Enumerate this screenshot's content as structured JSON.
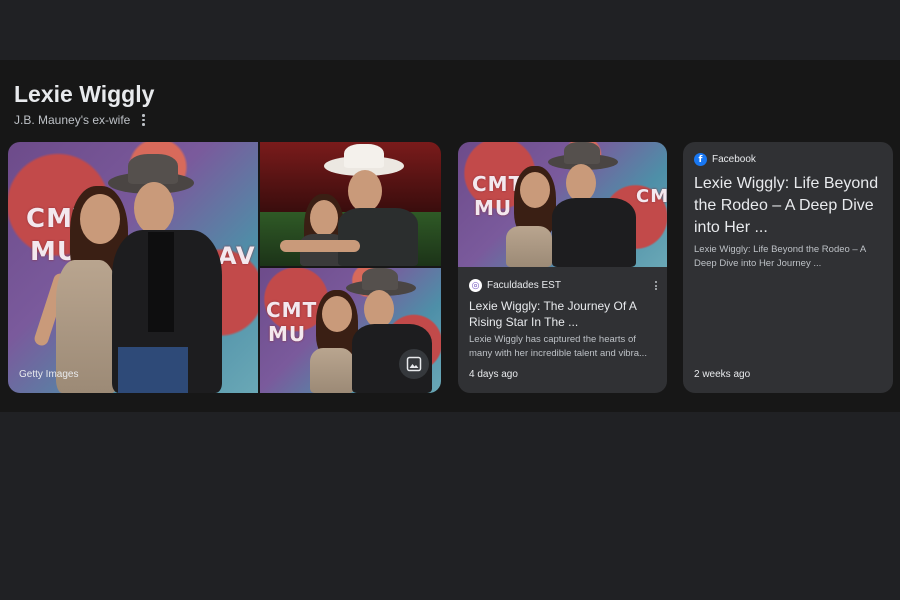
{
  "entity": {
    "title": "Lexie Wiggly",
    "subtitle": "J.B. Mauney's ex-wife"
  },
  "gallery": {
    "credit": "Getty Images",
    "wall_text_main_1": "CMT",
    "wall_text_main_2": "MU",
    "wall_text_main_3": "AV",
    "wall_text_small_1": "CMT",
    "wall_text_small_2": "MU"
  },
  "cards": [
    {
      "source": "Faculdades EST",
      "source_icon": "faculdades-logo-icon",
      "title": "Lexie Wiggly: The Journey Of A Rising Star In The ...",
      "snippet": "Lexie Wiggly has captured the hearts of many with her incredible talent and vibra...",
      "age": "4 days ago",
      "wall_text_1": "CMT",
      "wall_text_2": "MU",
      "wall_text_3": "CMT"
    },
    {
      "source": "Facebook",
      "source_icon": "facebook-icon",
      "title": "Lexie Wiggly: Life Beyond the Rodeo – A Deep Dive into Her ...",
      "snippet": "Lexie Wiggly: Life Beyond the Rodeo – A Deep Dive into Her Journey ...",
      "age": "2 weeks ago"
    }
  ],
  "colors": {
    "background": "#202124",
    "panel": "#171717",
    "card": "#303134",
    "facebook": "#1877f2"
  }
}
